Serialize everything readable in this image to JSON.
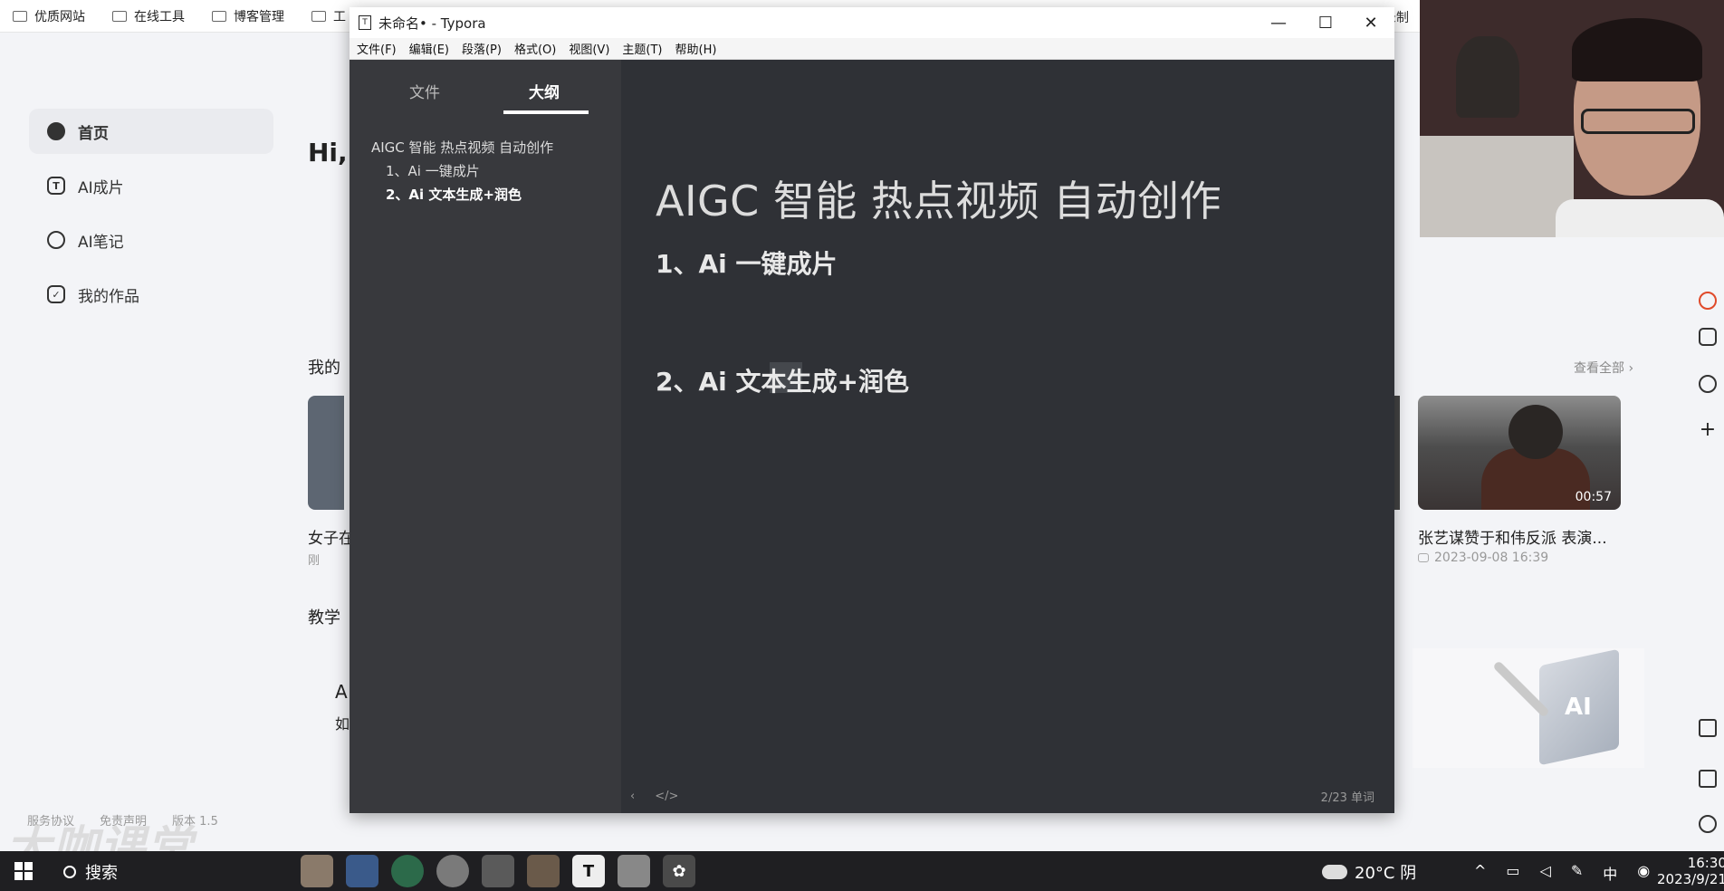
{
  "bookmarks": {
    "items": [
      "优质网站",
      "在线工具",
      "博客管理",
      "工"
    ],
    "right_partial": "录制"
  },
  "app": {
    "nav": [
      {
        "label": "首页"
      },
      {
        "label": "AI成片"
      },
      {
        "label": "AI笔记"
      },
      {
        "label": "我的作品"
      }
    ],
    "greeting": "Hi,",
    "section_works": "我的",
    "section_teach": "教学",
    "see_all": "查看全部 ›",
    "left_card_title": "女子在",
    "left_card_meta": "刚",
    "teach_line1": "A",
    "teach_line2": "如",
    "video": {
      "duration": "00:57",
      "title": "张艺谋赞于和伟反派 表演...",
      "date": "2023-09-08 16:39"
    },
    "footer": [
      "服务协议",
      "免责声明",
      "版本 1.5"
    ]
  },
  "typora": {
    "title": "未命名• - Typora",
    "menu": [
      "文件(F)",
      "编辑(E)",
      "段落(P)",
      "格式(O)",
      "视图(V)",
      "主题(T)",
      "帮助(H)"
    ],
    "tabs": [
      "文件",
      "大纲"
    ],
    "outline": [
      "AIGC 智能 热点视频 自动创作",
      "1、Ai 一键成片",
      "2、Ai 文本生成+润色"
    ],
    "doc": {
      "h1": "AIGC 智能 热点视频 自动创作",
      "h2_1": "1、Ai 一键成片",
      "h2_2": "2、Ai 文本生成+润色"
    },
    "word_count": "2/23 单词"
  },
  "watermark": "大咖课堂",
  "taskbar": {
    "search": "搜索",
    "weather": "20°C 阴",
    "ime": "中",
    "time": "16:30",
    "date": "2023/9/21"
  }
}
